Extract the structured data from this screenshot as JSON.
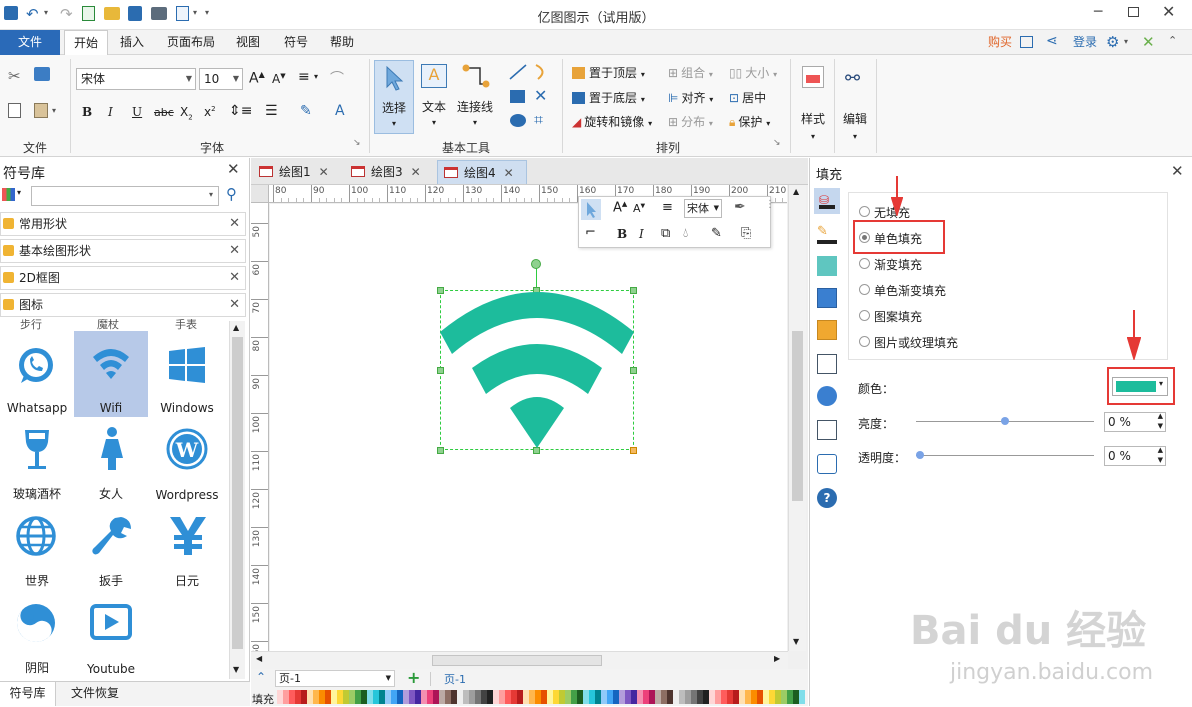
{
  "app": {
    "title": "亿图图示（试用版）"
  },
  "menu": {
    "file": "文件",
    "tabs": [
      "开始",
      "插入",
      "页面布局",
      "视图",
      "符号",
      "帮助"
    ],
    "buy": "购买",
    "login": "登录"
  },
  "ribbon": {
    "groups": {
      "file": "文件",
      "font": "字体",
      "basic_tools": "基本工具",
      "arrange": "排列"
    },
    "font_name": "宋体",
    "font_size": "10",
    "tools": {
      "select": "选择",
      "text": "文本",
      "connector": "连接线"
    },
    "arrange": {
      "bring_top": "置于顶层",
      "send_bottom": "置于底层",
      "rotate_mirror": "旋转和镜像",
      "group": "组合",
      "align": "对齐",
      "distribute": "分布",
      "size": "大小",
      "center": "居中",
      "protect": "保护"
    },
    "style": "样式",
    "edit": "编辑"
  },
  "left_panel": {
    "title": "符号库",
    "search_placeholder": "",
    "categories": [
      "常用形状",
      "基本绘图形状",
      "2D框图",
      "图标"
    ],
    "partial_row": [
      "步行",
      "魔杖",
      "手表"
    ],
    "symbols": [
      "Whatsapp",
      "Wifi",
      "Windows",
      "玻璃酒杯",
      "女人",
      "Wordpress",
      "世界",
      "扳手",
      "日元",
      "阴阳",
      "Youtube"
    ],
    "bottom_tabs": [
      "符号库",
      "文件恢复"
    ]
  },
  "doc_tabs": [
    "绘图1",
    "绘图3",
    "绘图4"
  ],
  "ruler": {
    "h": [
      "80",
      "90",
      "100",
      "110",
      "120",
      "130",
      "140",
      "150",
      "160",
      "170",
      "180",
      "190",
      "200",
      "210"
    ],
    "v": [
      "50",
      "60",
      "70",
      "80",
      "90",
      "100",
      "110",
      "120",
      "130",
      "140",
      "150",
      "160"
    ]
  },
  "page_bar": {
    "page_select": "页-1",
    "page_tab": "页-1",
    "fill_label": "填充"
  },
  "floating_toolbar": {
    "font": "宋体"
  },
  "shape": {
    "name": "Wifi",
    "color": "#1dbc9c"
  },
  "right_panel": {
    "title": "填充",
    "options": [
      "无填充",
      "单色填充",
      "渐变填充",
      "单色渐变填充",
      "图案填充",
      "图片或纹理填充"
    ],
    "selected": "单色填充",
    "color_label": "颜色：",
    "color_value": "#1dbc9c",
    "brightness_label": "亮度：",
    "brightness_value": "0 %",
    "brightness_level": 0.5,
    "transparency_label": "透明度：",
    "transparency_value": "0 %",
    "transparency_level": 0
  },
  "watermark": {
    "text": "Bai du 经验",
    "url": "jingyan.baidu.com"
  },
  "colors": {
    "accent": "#2b6cb0",
    "highlight_red": "#e53935",
    "file_tab": "#2a6ab8"
  }
}
